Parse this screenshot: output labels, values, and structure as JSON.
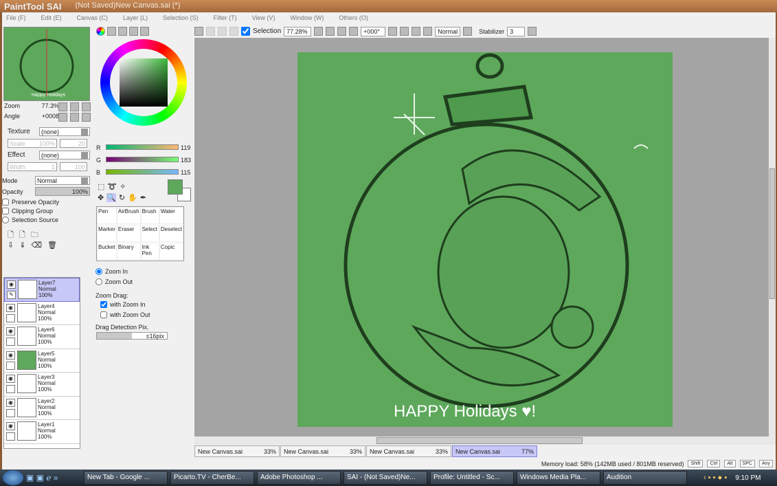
{
  "window": {
    "app": "PaintTool SAI",
    "title": "(Not Saved)New Canvas.sai (*)"
  },
  "menu": [
    "File (F)",
    "Edit (E)",
    "Canvas (C)",
    "Layer (L)",
    "Selection (S)",
    "Filter (T)",
    "View (V)",
    "Window (W)",
    "Others (O)"
  ],
  "toolbar": {
    "selection_label": "Selection",
    "zoom": "77.28%",
    "angle": "+000°",
    "blend": "Normal",
    "stabilizer_label": "Stabilizer",
    "stabilizer": "3"
  },
  "navigator": {
    "zoom_label": "Zoom",
    "zoom": "77.3%",
    "angle_label": "Angle",
    "angle": "+0008"
  },
  "brush": {
    "texture_label": "Texture",
    "texture": "(none)",
    "scale_label": "Scale",
    "scale": "100%",
    "scale2": "20",
    "effect_label": "Effect",
    "effect": "(none)",
    "width_label": "Width",
    "width": "1",
    "width2": "100"
  },
  "layer_props": {
    "mode_label": "Mode",
    "mode": "Normal",
    "opacity_label": "Opacity",
    "opacity": "100%",
    "preserve": "Preserve Opacity",
    "clipping": "Clipping Group",
    "selsource": "Selection Source"
  },
  "layers": [
    {
      "name": "Layer7",
      "mode": "Normal",
      "opacity": "100%",
      "active": true
    },
    {
      "name": "Layer4",
      "mode": "Normal",
      "opacity": "100%"
    },
    {
      "name": "Layer6",
      "mode": "Normal",
      "opacity": "100%"
    },
    {
      "name": "Layer5",
      "mode": "Normal",
      "opacity": "100%",
      "fill": "#5ea85c"
    },
    {
      "name": "Layer3",
      "mode": "Normal",
      "opacity": "100%"
    },
    {
      "name": "Layer2",
      "mode": "Normal",
      "opacity": "100%"
    },
    {
      "name": "Layer1",
      "mode": "Normal",
      "opacity": "100%"
    }
  ],
  "color": {
    "r_label": "R",
    "r": "119",
    "g_label": "G",
    "g": "183",
    "b_label": "B",
    "b": "115",
    "current": "#77b773"
  },
  "tools": [
    "Pen",
    "AirBrush",
    "Brush",
    "Water",
    "Marker",
    "Eraser",
    "Select",
    "Deselect",
    "Bucket",
    "Binary",
    "Ink Pen",
    "Copic"
  ],
  "zoom_tool": {
    "zoom_in": "Zoom In",
    "zoom_out": "Zoom Out",
    "drag_label": "Zoom Drag:",
    "with_in": "with Zoom In",
    "with_out": "with Zoom Out",
    "detect_label": "Drag Detection Pix.",
    "detect": "±16pix"
  },
  "artwork": {
    "caption": "HAPPY Holidays ♥!"
  },
  "tabs": [
    {
      "name": "New Canvas.sai",
      "zoom": "33%"
    },
    {
      "name": "New Canvas.sai",
      "zoom": "33%"
    },
    {
      "name": "New Canvas.sai",
      "zoom": "33%"
    },
    {
      "name": "New Canvas.sai",
      "zoom": "77%",
      "active": true
    }
  ],
  "status": {
    "memory": "Memory load: 58% (142MB used / 801MB reserved)",
    "keys": [
      "Shift",
      "Ctrl",
      "Alt",
      "SPC",
      "Any"
    ]
  },
  "taskbar": {
    "items": [
      "New Tab - Google ...",
      "Picarto.TV - CherBe...",
      "Adobe Photoshop ...",
      "SAI - (Not Saved)Ne...",
      "Profile: Untitled - Sc...",
      "Windows Media Pla...",
      "Audition"
    ],
    "time": "9:10 PM"
  }
}
